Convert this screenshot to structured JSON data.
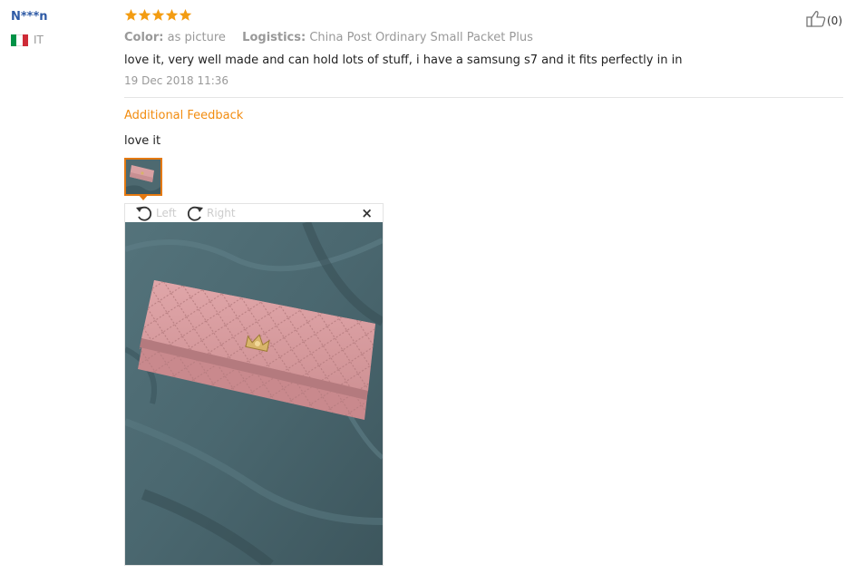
{
  "reviewer": {
    "name": "N***n",
    "country_code": "IT",
    "flag_colors": [
      "#009246",
      "#ffffff",
      "#ce2b37"
    ]
  },
  "review": {
    "rating": 5,
    "max_rating": 5,
    "star_color": "#f39c12",
    "color_label": "Color:",
    "color_value": "as picture",
    "logistics_label": "Logistics:",
    "logistics_value": "China Post Ordinary Small Packet Plus",
    "text": "love it, very well made and can hold lots of stuff, i have a samsung s7 and it fits perfectly in in",
    "date": "19 Dec 2018 11:36",
    "helpful_count": "(0)"
  },
  "additional_feedback": {
    "title": "Additional Feedback",
    "text": "love it",
    "accent_color": "#f28c0f"
  },
  "image_viewer": {
    "rotate_left_label": "Left",
    "rotate_right_label": "Right",
    "close_label": "×",
    "image_subject": "pink quilted wallet on teal fabric"
  }
}
